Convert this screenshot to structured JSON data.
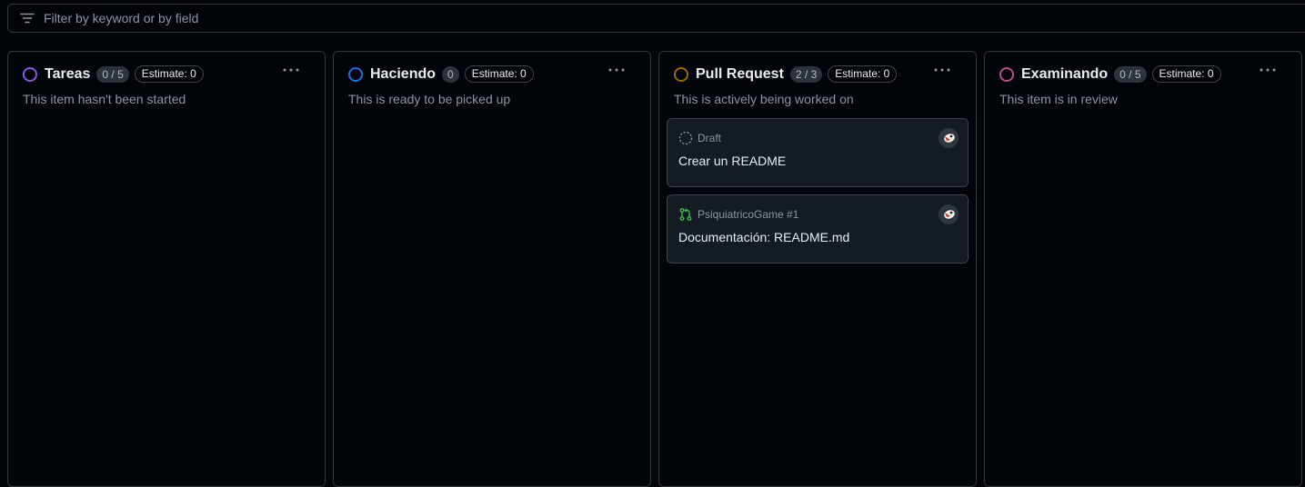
{
  "filter": {
    "placeholder": "Filter by keyword or by field"
  },
  "colors": {
    "tareas": "#8957e5",
    "haciendo": "#1f6feb",
    "pull_request": "#9e6a03",
    "examinando": "#bf4b8a",
    "pr_icon": "#3fb950"
  },
  "columns": [
    {
      "title": "Tareas",
      "count": "0 / 5",
      "estimate": "Estimate: 0",
      "description": "This item hasn't been started"
    },
    {
      "title": "Haciendo",
      "count": "0",
      "estimate": "Estimate: 0",
      "description": "This is ready to be picked up"
    },
    {
      "title": "Pull Request",
      "count": "2 / 3",
      "estimate": "Estimate: 0",
      "description": "This is actively being worked on",
      "cards": [
        {
          "meta": "Draft",
          "meta_icon": "draft-circle-icon",
          "title": "Crear un README"
        },
        {
          "meta": "PsiquiatricoGame #1",
          "meta_icon": "pull-request-icon",
          "title": "Documentación: README.md"
        }
      ]
    },
    {
      "title": "Examinando",
      "count": "0 / 5",
      "estimate": "Estimate: 0",
      "description": "This item is in review"
    }
  ]
}
